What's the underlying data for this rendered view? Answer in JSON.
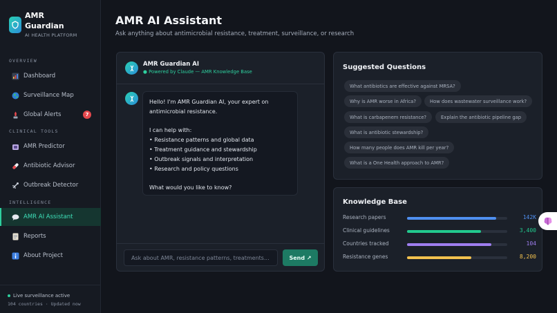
{
  "brand": {
    "name": "AMR Guardian",
    "subtitle": "AI HEALTH PLATFORM"
  },
  "sidebar": {
    "sections": [
      {
        "label": "OVERVIEW"
      },
      {
        "label": "CLINICAL TOOLS"
      },
      {
        "label": "INTELLIGENCE"
      }
    ],
    "items": [
      {
        "label": "Dashboard",
        "icon": "bar-chart-icon"
      },
      {
        "label": "Surveillance Map",
        "icon": "globe-icon"
      },
      {
        "label": "Global Alerts",
        "icon": "alert-icon",
        "badge": "7"
      },
      {
        "label": "AMR Predictor",
        "icon": "microscope-icon"
      },
      {
        "label": "Antibiotic Advisor",
        "icon": "pill-icon"
      },
      {
        "label": "Outbreak Detector",
        "icon": "satellite-icon"
      },
      {
        "label": "AMR AI Assistant",
        "icon": "chat-bubble-icon",
        "active": true
      },
      {
        "label": "Reports",
        "icon": "document-icon"
      },
      {
        "label": "About Project",
        "icon": "info-icon"
      }
    ],
    "footer": {
      "status": "Live surveillance active",
      "meta": "104 countries · Updated now"
    }
  },
  "page": {
    "title": "AMR AI Assistant",
    "subtitle": "Ask anything about antimicrobial resistance, treatment, surveillance, or research"
  },
  "chat": {
    "assistant_name": "AMR Guardian AI",
    "powered_by": "● Powered by Claude — AMR Knowledge Base",
    "message_lines": [
      "Hello! I'm AMR Guardian AI, your expert on",
      "antimicrobial resistance.",
      "",
      "I can help with:",
      "• Resistance patterns and global data",
      "• Treatment guidance and stewardship",
      "• Outbreak signals and interpretation",
      "• Research and policy questions",
      "",
      "What would you like to know?"
    ],
    "input_placeholder": "Ask about AMR, resistance patterns, treatments...",
    "input_value": "",
    "send_label": "Send ↗"
  },
  "suggested": {
    "title": "Suggested Questions",
    "questions": [
      "What antibiotics are effective against MRSA?",
      "Why is AMR worse in Africa?",
      "How does wastewater surveillance work?",
      "What is carbapenem resistance?",
      "Explain the antibiotic pipeline gap",
      "What is antibiotic stewardship?",
      "How many people does AMR kill per year?",
      "What is a One Health approach to AMR?"
    ]
  },
  "knowledge_base": {
    "title": "Knowledge Base",
    "rows": [
      {
        "label": "Research papers",
        "value": "142K",
        "fill": 0.89,
        "color": "#4f8ff0"
      },
      {
        "label": "Clinical guidelines",
        "value": "3,400",
        "fill": 0.74,
        "color": "#22c98e"
      },
      {
        "label": "Countries tracked",
        "value": "104",
        "fill": 0.84,
        "color": "#9f7ef0"
      },
      {
        "label": "Resistance genes",
        "value": "8,200",
        "fill": 0.64,
        "color": "#f2c14e"
      }
    ]
  },
  "colors": {
    "accent": "#2ecf9e",
    "alert": "#e5484d",
    "background": "#12151c"
  }
}
